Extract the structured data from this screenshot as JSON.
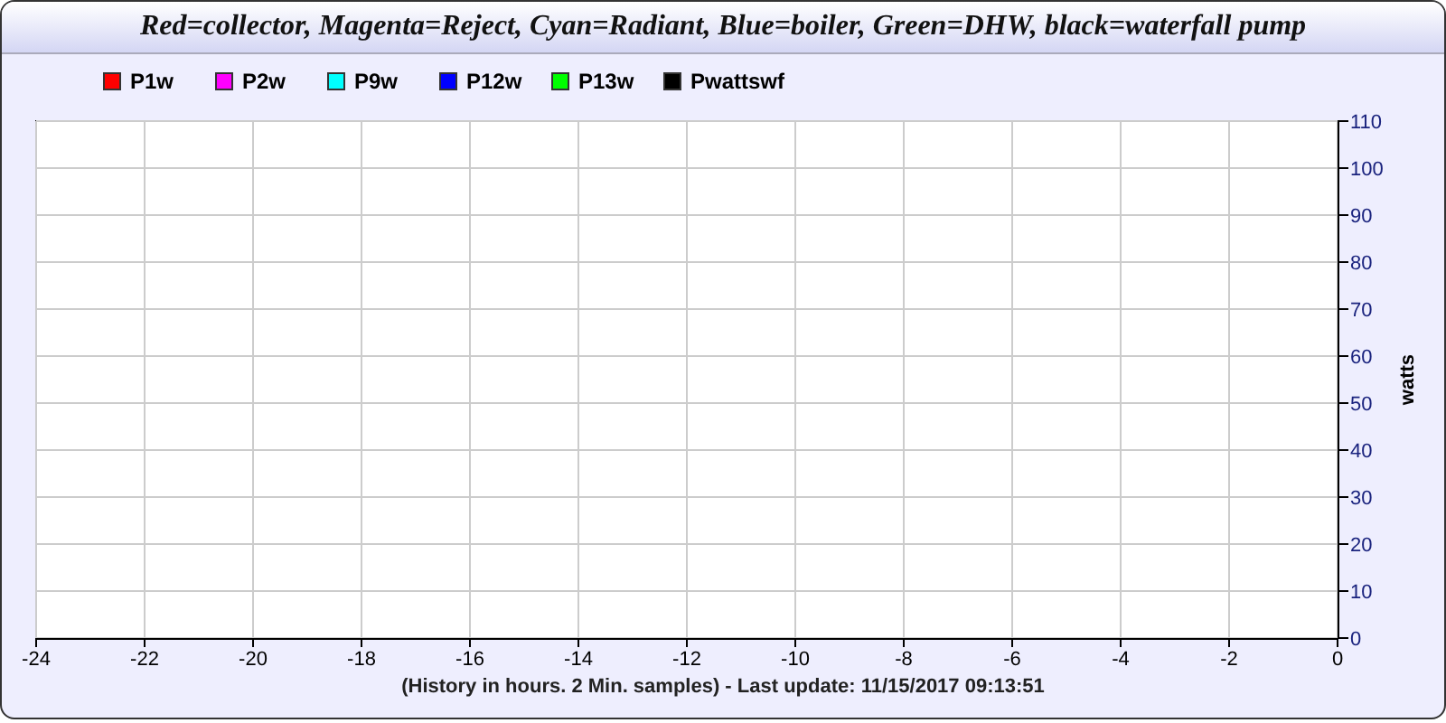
{
  "window": {
    "title": "Red=collector, Magenta=Reject, Cyan=Radiant, Blue=boiler, Green=DHW, black=waterfall pump"
  },
  "chart_data": {
    "type": "line",
    "xlabel": "(History in hours. 2 Min. samples) - Last update: 11/15/2017 09:13:51",
    "ylabel": "watts",
    "grid": true,
    "ylim": [
      0,
      110
    ],
    "categories": [
      "-24",
      "-22",
      "-20",
      "-18",
      "-16",
      "-14",
      "-12",
      "-10",
      "-8",
      "-6",
      "-4",
      "-2",
      "0"
    ],
    "yticks": [
      0,
      10,
      20,
      30,
      40,
      50,
      60,
      70,
      80,
      90,
      100,
      110
    ],
    "series": [
      {
        "name": "P1w",
        "color": "#ff0000",
        "values": [
          null,
          null,
          null,
          null,
          null,
          null,
          null,
          null,
          null,
          null,
          null,
          null,
          null
        ]
      },
      {
        "name": "P2w",
        "color": "#ff00ff",
        "values": [
          null,
          null,
          null,
          null,
          null,
          null,
          null,
          null,
          null,
          null,
          null,
          null,
          null
        ]
      },
      {
        "name": "P9w",
        "color": "#00ffff",
        "values": [
          null,
          null,
          null,
          null,
          null,
          null,
          null,
          null,
          null,
          null,
          null,
          null,
          null
        ]
      },
      {
        "name": "P12w",
        "color": "#0000ff",
        "values": [
          null,
          null,
          null,
          null,
          null,
          null,
          null,
          null,
          null,
          null,
          null,
          null,
          null
        ]
      },
      {
        "name": "P13w",
        "color": "#00ff00",
        "values": [
          null,
          null,
          null,
          null,
          null,
          null,
          null,
          null,
          null,
          null,
          null,
          null,
          null
        ]
      },
      {
        "name": "Pwattswf",
        "color": "#000000",
        "values": [
          null,
          null,
          null,
          null,
          null,
          null,
          null,
          null,
          null,
          null,
          null,
          null,
          null
        ]
      }
    ]
  }
}
